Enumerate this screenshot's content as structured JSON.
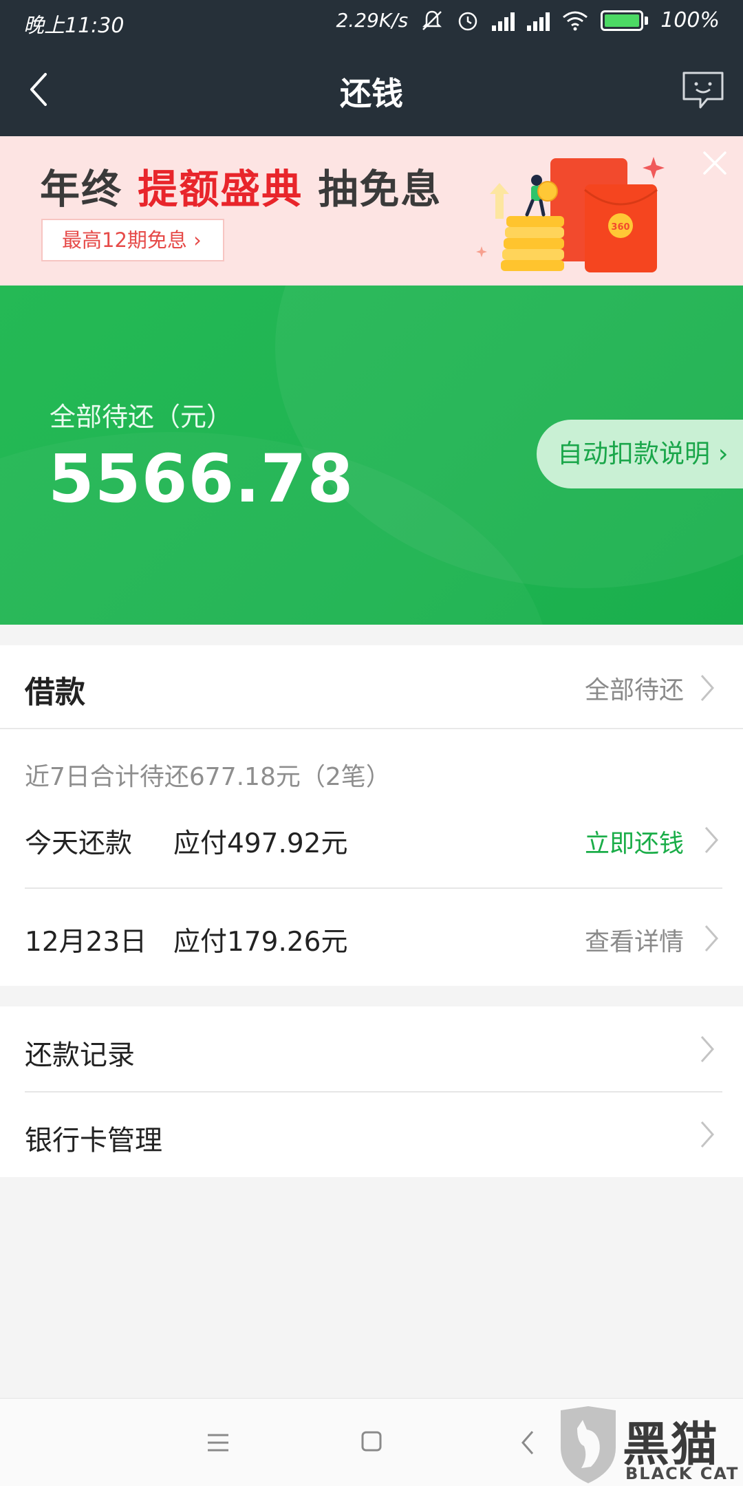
{
  "status_bar": {
    "time": "晚上11:30",
    "net_speed": "2.29K/s",
    "battery": "100%"
  },
  "nav": {
    "title": "还钱"
  },
  "banner": {
    "headline_part1": "年终 ",
    "headline_highlight": "提额盛典",
    "headline_part2": " 抽免息",
    "pill_text": "最高12期免息 ›"
  },
  "summary": {
    "label": "全部待还（元）",
    "amount": "5566.78",
    "auto_deduct_button": "自动扣款说明 ›"
  },
  "loan": {
    "title": "借款",
    "all_link": "全部待还",
    "week_summary": "近7日合计待还677.18元（2笔）",
    "rows": [
      {
        "date": "今天还款",
        "due": "应付497.92元",
        "action": "立即还钱",
        "action_color": "#1aad48"
      },
      {
        "date": "12月23日",
        "due": "应付179.26元",
        "action": "查看详情",
        "action_color": "#8a8a8a"
      }
    ]
  },
  "menu": {
    "items": [
      {
        "label": "还款记录"
      },
      {
        "label": "银行卡管理"
      }
    ]
  },
  "watermark": {
    "cn": "黑猫",
    "en": "BLACK CAT"
  },
  "colors": {
    "accent_green": "#1fb452",
    "banner_red": "#e8252b",
    "navbar_bg": "#263039"
  }
}
